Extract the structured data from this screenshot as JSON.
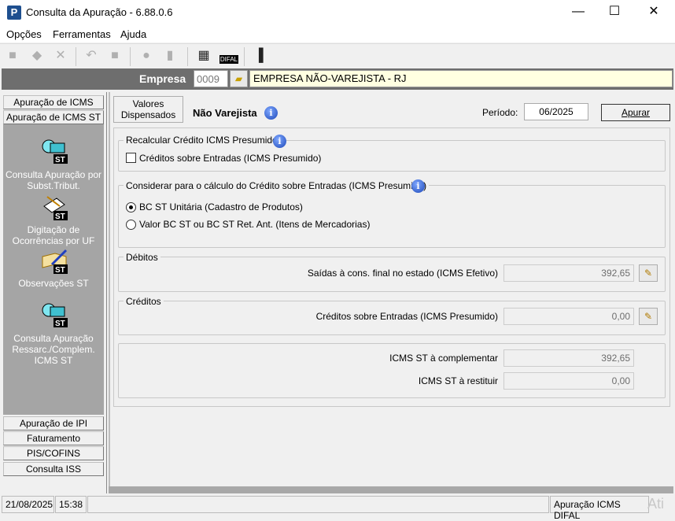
{
  "window": {
    "title": "Consulta da Apuração - 6.88.0.6",
    "app_icon": "P",
    "minimize": "—",
    "maximize": "☐",
    "close": "✕"
  },
  "menu": [
    "Opções",
    "Ferramentas",
    "Ajuda"
  ],
  "toolbar": {
    "icons": [
      "new-icon",
      "edit-icon",
      "delete-icon",
      "undo-icon",
      "stop-icon",
      "print-icon",
      "truck-icon",
      "export-icon",
      "difal-icon",
      "exit-icon"
    ],
    "difal_label": "DIFAL"
  },
  "empresa": {
    "label": "Empresa",
    "code": "0009",
    "name": "EMPRESA NÃO-VAREJISTA - RJ"
  },
  "sidebar": {
    "top_tabs": [
      "Apuração de ICMS",
      "Apuração de ICMS ST"
    ],
    "items": [
      "Consulta  Apuração por Subst.Tribut.",
      "Digitação de Ocorrências por UF",
      "Observações ST",
      "Consulta Apuração Ressarc./Complem. ICMS ST"
    ],
    "icon_badge": "ST",
    "bottom_tabs": [
      "Apuração de IPI",
      "Faturamento",
      "PIS/COFINS",
      "Consulta ISS"
    ]
  },
  "main": {
    "valores_btn": "Valores Dispensados",
    "mode": "Não Varejista",
    "periodo_label": "Período:",
    "periodo": "06/2025",
    "apurar": "Apurar",
    "recalc": {
      "title": "Recalcular Crédito ICMS Presumido",
      "checkbox": "Créditos sobre Entradas (ICMS Presumido)",
      "checked": false
    },
    "considerar": {
      "title": "Considerar para o cálculo do Crédito sobre Entradas (ICMS Presumido)",
      "options": [
        "BC ST Unitária (Cadastro de Produtos)",
        "Valor BC ST ou BC ST Ret. Ant. (Itens de Mercadorias)"
      ],
      "selected": 0
    },
    "debitos": {
      "title": "Débitos",
      "label": "Saídas à cons. final no estado (ICMS Efetivo)",
      "value": "392,65"
    },
    "creditos": {
      "title": "Créditos",
      "label": "Créditos sobre Entradas (ICMS Presumido)",
      "value": "0,00"
    },
    "totais": [
      {
        "label": "ICMS ST à complementar",
        "value": "392,65"
      },
      {
        "label": "ICMS ST à restituir",
        "value": "0,00"
      }
    ]
  },
  "status": {
    "date": "21/08/2025",
    "time": "15:38",
    "module": "Apuração ICMS DIFAL",
    "watermark": "Ati"
  }
}
